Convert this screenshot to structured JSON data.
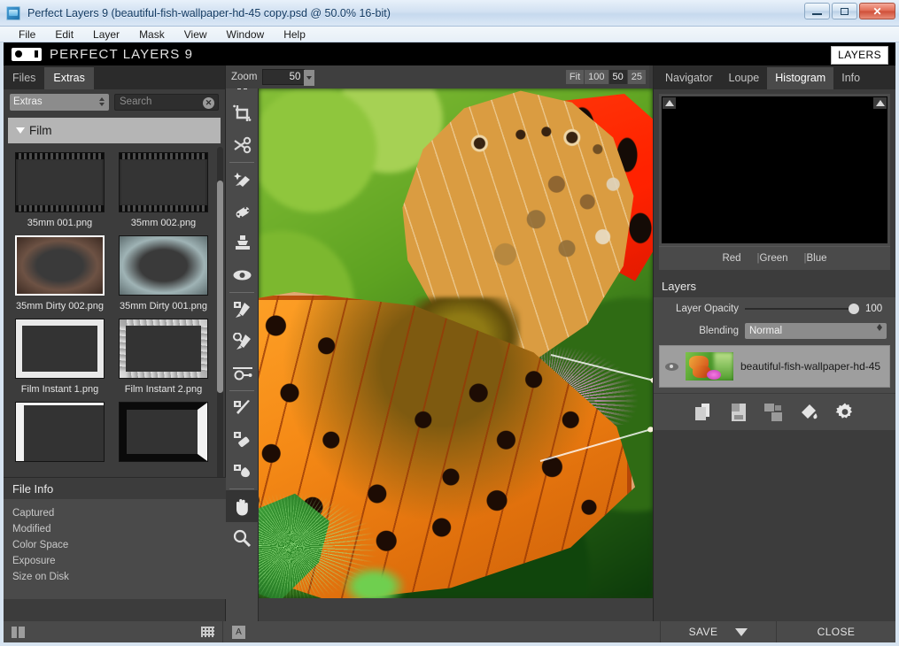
{
  "window": {
    "title": "Perfect Layers 9 (beautiful-fish-wallpaper-hd-45 copy.psd @ 50.0% 16-bit)",
    "icon": "app-icon",
    "buttons": {
      "minimize": "minimize-icon",
      "maximize": "maximize-icon",
      "close": "✕"
    }
  },
  "menubar": {
    "items": [
      "File",
      "Edit",
      "Layer",
      "Mask",
      "View",
      "Window",
      "Help"
    ]
  },
  "header": {
    "logo": "on1-logo",
    "title": "PERFECT LAYERS 9",
    "layers_chip": "LAYERS"
  },
  "browser": {
    "tabs": [
      {
        "label": "Files",
        "active": false
      },
      {
        "label": "Extras",
        "active": true
      }
    ],
    "source_select": {
      "value": "Extras"
    },
    "search": {
      "value": "",
      "placeholder": "Search",
      "clear": "✕"
    },
    "category": {
      "label": "Film",
      "expanded": true
    },
    "thumbnails": [
      {
        "label": "35mm 001.png",
        "style": "film",
        "selected": false
      },
      {
        "label": "35mm 002.png",
        "style": "film",
        "selected": false
      },
      {
        "label": "35mm Dirty 002.png",
        "style": "dirty-a",
        "selected": true
      },
      {
        "label": "35mm Dirty  001.png",
        "style": "dirty-b",
        "selected": false
      },
      {
        "label": "Film Instant 1.png",
        "style": "instant-a",
        "selected": false
      },
      {
        "label": "Film Instant 2.png",
        "style": "instant-b",
        "selected": false
      },
      {
        "label": "",
        "style": "instant-c",
        "selected": false
      },
      {
        "label": "",
        "style": "instant-d",
        "selected": false
      }
    ]
  },
  "file_info": {
    "title": "File Info",
    "rows": [
      "Captured",
      "Modified",
      "Color Space",
      "Exposure",
      "Size on Disk"
    ]
  },
  "toolbar": {
    "tools": [
      {
        "name": "transform-tool",
        "selected": false
      },
      {
        "name": "crop-tool",
        "selected": false
      },
      {
        "name": "trim-tool",
        "selected": false
      },
      {
        "name": "perfect-eraser-tool",
        "selected": false
      },
      {
        "name": "retouch-brush-tool",
        "selected": false
      },
      {
        "name": "clone-stamp-tool",
        "selected": false
      },
      {
        "name": "red-eye-tool",
        "selected": false
      },
      {
        "name": "masking-brush-tool",
        "selected": false
      },
      {
        "name": "refine-brush-tool",
        "selected": false
      },
      {
        "name": "masking-bug-tool",
        "selected": false
      },
      {
        "name": "chisel-tool",
        "selected": false
      },
      {
        "name": "blur-tool",
        "selected": false
      },
      {
        "name": "paint-tool",
        "selected": false
      },
      {
        "name": "pan-tool",
        "selected": true
      },
      {
        "name": "zoom-tool",
        "selected": false
      }
    ]
  },
  "zoombar": {
    "label": "Zoom",
    "value": "50",
    "presets": [
      {
        "label": "Fit",
        "active": false
      },
      {
        "label": "100",
        "active": false
      },
      {
        "label": "50",
        "active": true
      },
      {
        "label": "25",
        "active": false
      }
    ]
  },
  "document": {
    "tab_label": "beautiful-fish-wallpaper-hd-45 copy.psd @ 50.0% 16-bit",
    "close": "X",
    "image_description": "Orange fritillary butterfly with black spots perched on a magenta thistle flower, blurred green background"
  },
  "inspector": {
    "tabs": [
      {
        "label": "Navigator",
        "active": false
      },
      {
        "label": "Loupe",
        "active": false
      },
      {
        "label": "Histogram",
        "active": true
      },
      {
        "label": "Info",
        "active": false
      }
    ],
    "histogram": {
      "background": "#000000",
      "channels": [
        {
          "label": "Red",
          "sep": ""
        },
        {
          "label": "Green",
          "sep": "|"
        },
        {
          "label": "Blue",
          "sep": "|"
        }
      ]
    }
  },
  "layers": {
    "title": "Layers",
    "opacity": {
      "label": "Layer Opacity",
      "value": "100"
    },
    "blending": {
      "label": "Blending",
      "value": "Normal"
    },
    "items": [
      {
        "name": "beautiful-fish-wallpaper-hd-45",
        "visible": true,
        "selected": true
      }
    ],
    "buttons": [
      {
        "name": "copy-layer-icon"
      },
      {
        "name": "save-layer-icon"
      },
      {
        "name": "refresh-layer-icon"
      },
      {
        "name": "fill-layer-icon"
      },
      {
        "name": "layer-settings-gear-icon"
      }
    ]
  },
  "statusbar": {
    "panes_icon": "toggle-panes-icon",
    "grid_icon": "grid-view-icon",
    "a_button": "A",
    "save_label": "SAVE",
    "save_dropdown": "dropdown-arrow-icon",
    "close_label": "CLOSE"
  },
  "colors": {
    "panel_bg": "#3c3c3c",
    "panel_light": "#4a4a4a",
    "tab_bar": "#2b2b2b",
    "header_black": "#000000",
    "accent_white": "#ffffff",
    "titlebar": "#cddff0"
  }
}
